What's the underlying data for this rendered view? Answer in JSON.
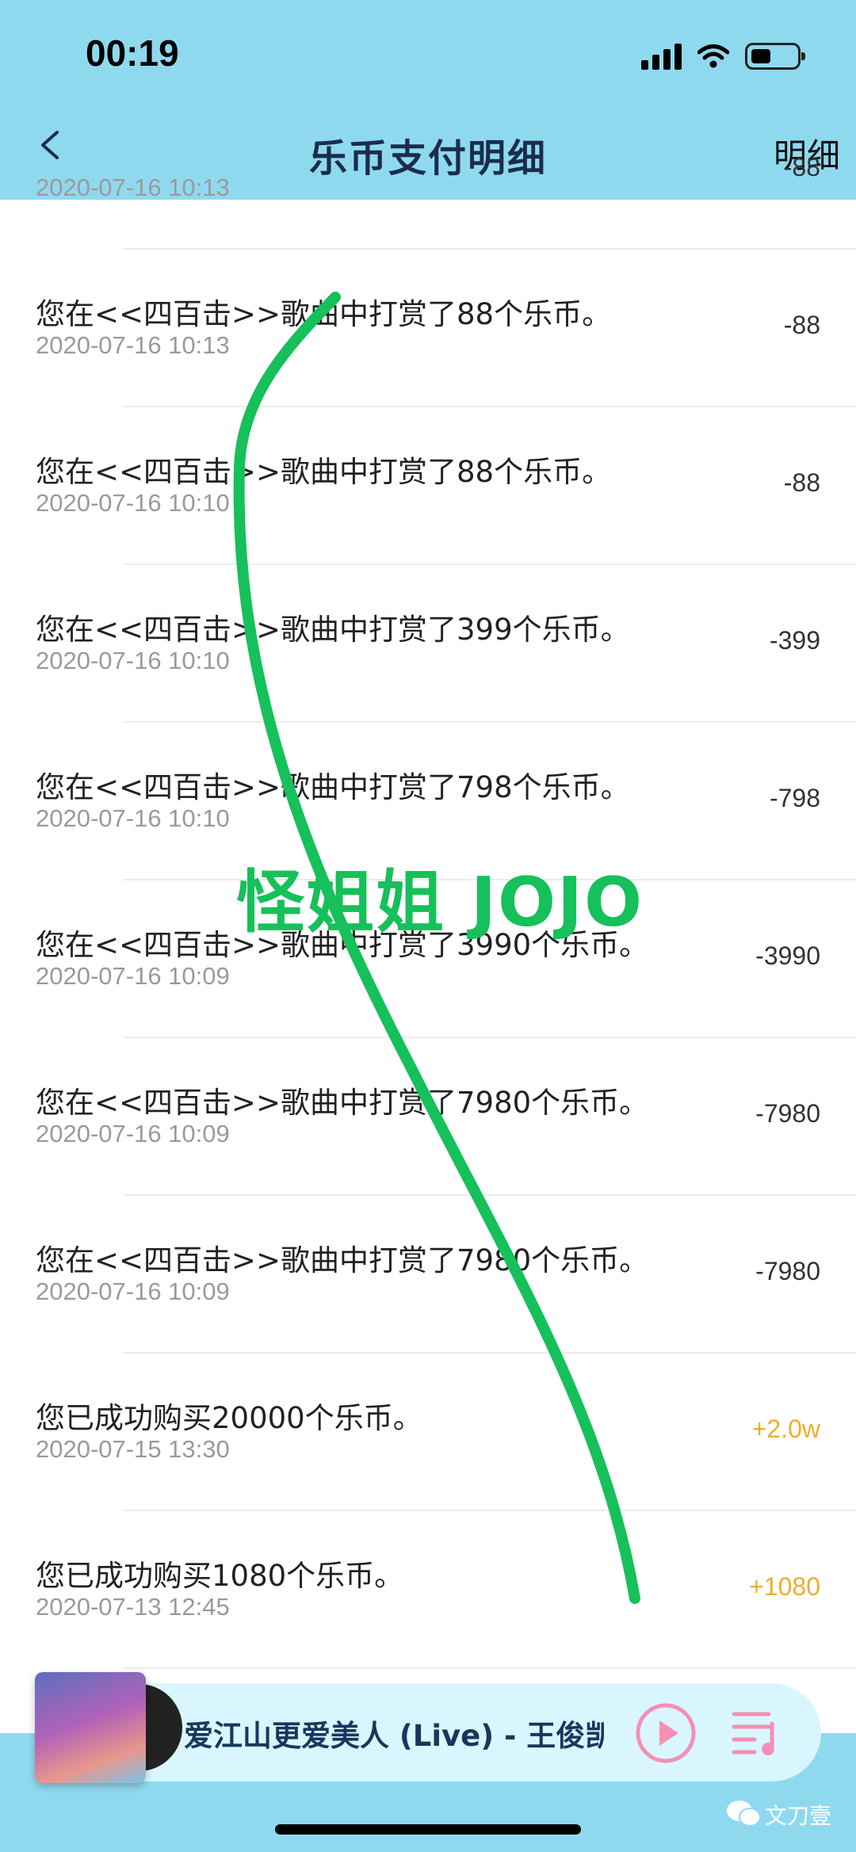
{
  "status_bar": {
    "time": "00:19"
  },
  "header": {
    "title": "乐币支付明细",
    "right_link": "明细"
  },
  "records": [
    {
      "description": "",
      "date": "2020-07-16 10:13",
      "amount": "-88",
      "type": "debit"
    },
    {
      "description": "您在<<四百击>>歌曲中打赏了88个乐币。",
      "date": "2020-07-16 10:13",
      "amount": "-88",
      "type": "debit"
    },
    {
      "description": "您在<<四百击>>歌曲中打赏了88个乐币。",
      "date": "2020-07-16 10:10",
      "amount": "-88",
      "type": "debit"
    },
    {
      "description": "您在<<四百击>>歌曲中打赏了399个乐币。",
      "date": "2020-07-16 10:10",
      "amount": "-399",
      "type": "debit"
    },
    {
      "description": "您在<<四百击>>歌曲中打赏了798个乐币。",
      "date": "2020-07-16 10:10",
      "amount": "-798",
      "type": "debit"
    },
    {
      "description": "您在<<四百击>>歌曲中打赏了3990个乐币。",
      "date": "2020-07-16 10:09",
      "amount": "-3990",
      "type": "debit"
    },
    {
      "description": "您在<<四百击>>歌曲中打赏了7980个乐币。",
      "date": "2020-07-16 10:09",
      "amount": "-7980",
      "type": "debit"
    },
    {
      "description": "您在<<四百击>>歌曲中打赏了7980个乐币。",
      "date": "2020-07-16 10:09",
      "amount": "-7980",
      "type": "debit"
    },
    {
      "description": "您已成功购买20000个乐币。",
      "date": "2020-07-15 13:30",
      "amount": "+2.0w",
      "type": "credit"
    },
    {
      "description": "您已成功购买1080个乐币。",
      "date": "2020-07-13 12:45",
      "amount": "+1080",
      "type": "credit"
    }
  ],
  "player": {
    "song_title": "爱江山更爱美人 (Live) - 王俊凯"
  },
  "overlay": {
    "annotation_text": "怪姐姐 JOJO",
    "annotation_color": "#16c05a"
  },
  "watermark": {
    "text": "文刀壹"
  },
  "colors": {
    "header_bg": "#8fd9ef",
    "credit": "#f0ad2f",
    "title": "#1a2d4d",
    "player_accent": "#f58fb4"
  }
}
